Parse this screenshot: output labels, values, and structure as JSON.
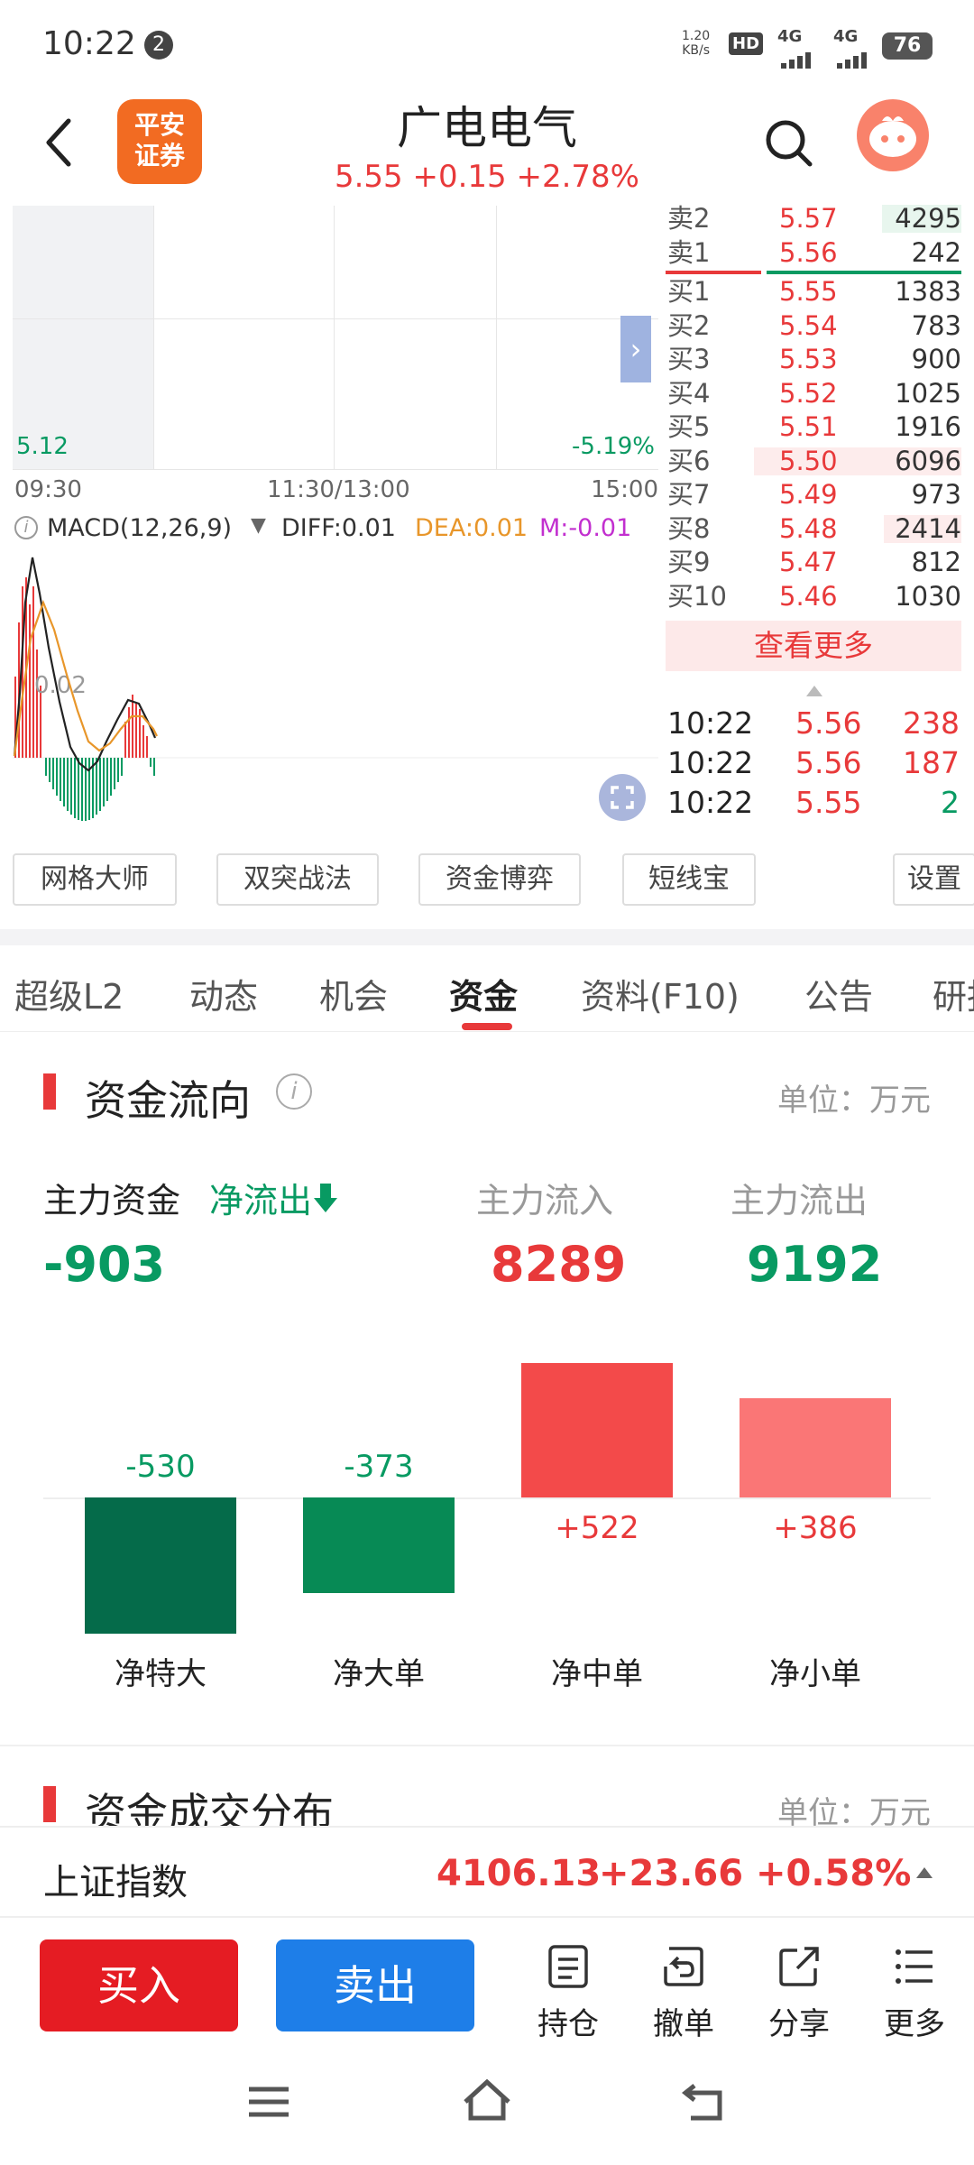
{
  "status": {
    "time": "10:22",
    "notif_count": "2",
    "net_speed": "1.20",
    "net_unit": "KB/s",
    "hd": "HD",
    "sim": "1 2",
    "sig1": "4G",
    "sig2": "4G",
    "battery": "76"
  },
  "header": {
    "logo_text": "平安\n证券",
    "stock_name": "广电电气",
    "price_line": "5.55 +0.15 +2.78%"
  },
  "intraday": {
    "low_price": "5.12",
    "low_pct": "-5.19%",
    "time_start": "09:30",
    "time_mid": "11:30/13:00",
    "time_end": "15:00"
  },
  "macd": {
    "title": "MACD(12,26,9)",
    "diff": "DIFF:0.01",
    "dea": "DEA:0.01",
    "m": "M:-0.01",
    "axis_label": "0.02"
  },
  "order_book": {
    "asks": [
      {
        "label": "卖2",
        "price": "5.57",
        "vol": "4295"
      },
      {
        "label": "卖1",
        "price": "5.56",
        "vol": "242"
      }
    ],
    "bids": [
      {
        "label": "买1",
        "price": "5.55",
        "vol": "1383"
      },
      {
        "label": "买2",
        "price": "5.54",
        "vol": "783"
      },
      {
        "label": "买3",
        "price": "5.53",
        "vol": "900"
      },
      {
        "label": "买4",
        "price": "5.52",
        "vol": "1025"
      },
      {
        "label": "买5",
        "price": "5.51",
        "vol": "1916"
      },
      {
        "label": "买6",
        "price": "5.50",
        "vol": "6096"
      },
      {
        "label": "买7",
        "price": "5.49",
        "vol": "973"
      },
      {
        "label": "买8",
        "price": "5.48",
        "vol": "2414"
      },
      {
        "label": "买9",
        "price": "5.47",
        "vol": "812"
      },
      {
        "label": "买10",
        "price": "5.46",
        "vol": "1030"
      }
    ],
    "more_label": "查看更多"
  },
  "trades": [
    {
      "time": "10:22",
      "price": "5.56",
      "vol": "238"
    },
    {
      "time": "10:22",
      "price": "5.56",
      "vol": "187"
    },
    {
      "time": "10:22",
      "price": "5.55",
      "vol": "2"
    }
  ],
  "tools": [
    "网格大师",
    "双突战法",
    "资金博弈",
    "短线宝",
    "设置"
  ],
  "tabs": [
    "超级L2",
    "动态",
    "机会",
    "资金",
    "资料(F10)",
    "公告",
    "研报"
  ],
  "fund_flow": {
    "title": "资金流向",
    "unit": "单位：万元",
    "main_label": "主力资金",
    "net_flag": "净流出",
    "net_value": "-903",
    "inflow_label": "主力流入",
    "inflow_value": "8289",
    "outflow_label": "主力流出",
    "outflow_value": "9192"
  },
  "chart_data": {
    "type": "bar",
    "categories": [
      "净特大",
      "净大单",
      "净中单",
      "净小单"
    ],
    "values": [
      -530,
      -373,
      522,
      386
    ],
    "value_labels": [
      "-530",
      "-373",
      "+522",
      "+386"
    ],
    "colors": [
      "#056b4a",
      "#078a55",
      "#f34a4a",
      "#fa7676"
    ]
  },
  "distribution": {
    "title": "资金成交分布",
    "unit": "单位：万元"
  },
  "index": {
    "name": "上证指数",
    "value": "4106.13",
    "change": "+23.66",
    "pct": "+0.58%"
  },
  "actions": {
    "buy": "买入",
    "sell": "卖出",
    "items": [
      "持仓",
      "撤单",
      "分享",
      "更多"
    ]
  },
  "colors": {
    "up": "#e8393a",
    "down": "#089a62",
    "accent_blue": "#1e7ee8"
  }
}
